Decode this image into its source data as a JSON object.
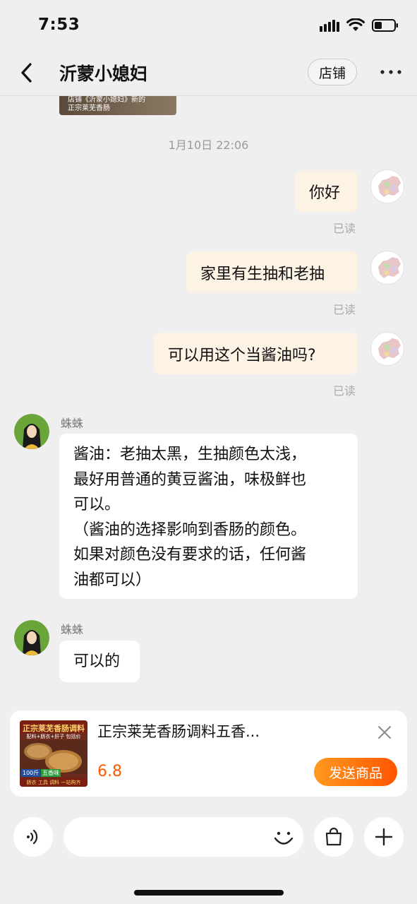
{
  "status_bar": {
    "time": "7:53"
  },
  "header": {
    "title": "沂蒙小媳妇",
    "store_label": "店铺"
  },
  "previous_card": {
    "line1": "店铺《沂蒙小媳妇》新的",
    "line2": "正宗莱芜香肠"
  },
  "timestamp": "1月10日 22:06",
  "messages_right": [
    {
      "text": "你好",
      "status": "已读"
    },
    {
      "text": "家里有生抽和老抽",
      "status": "已读"
    },
    {
      "text": "可以用这个当酱油吗?",
      "status": "已读"
    }
  ],
  "messages_left": [
    {
      "sender": "蛛蛛",
      "lines": [
        "酱油：老抽太黑，生抽颜色太浅，",
        "最好用普通的黄豆酱油，味极鲜也",
        "可以。",
        "（酱油的选择影响到香肠的颜色。",
        "如果对颜色没有要求的话，任何酱",
        "油都可以）"
      ]
    },
    {
      "sender": "蛛蛛",
      "lines": [
        "可以的"
      ]
    }
  ],
  "product": {
    "title": "正宗莱芜香肠调料五香...",
    "price": "6.8",
    "send_label": "发送商品",
    "thumb_title": "正宗莱芜香肠调料",
    "thumb_sub": "配料+肠衣+肝子 包括价",
    "thumb_badge": "100斤",
    "thumb_badge2": "五香味",
    "thumb_bottom": "肠衣 工具 调料 一站购齐"
  },
  "input": {
    "placeholder": ""
  },
  "colors": {
    "accent": "#ff5500",
    "price": "#ff5b00",
    "bubble_self": "#fdf3e4",
    "background": "#efefef"
  }
}
